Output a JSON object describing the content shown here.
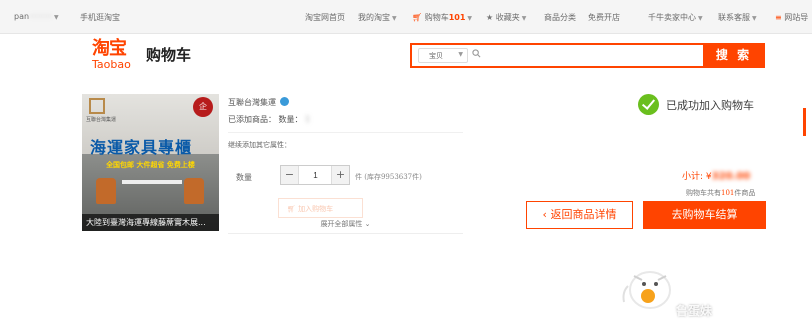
{
  "topbar": {
    "user": "pan",
    "user_blurred": "·········",
    "mobile": "手机逛淘宝",
    "home": "淘宝网首页",
    "my_taobao": "我的淘宝",
    "cart_label": "购物车",
    "cart_count": "101",
    "favorites": "收藏夹",
    "categories": "商品分类",
    "open_shop": "免费开店",
    "seller_center": "千牛卖家中心",
    "support": "联系客服",
    "sitemap": "网站导"
  },
  "header": {
    "logo_cn": "淘宝",
    "logo_en": "Taobao",
    "title": "购物车"
  },
  "search": {
    "scope": "宝贝",
    "value": "",
    "button": "搜 索"
  },
  "product": {
    "image_headline": "海運家具專櫃",
    "image_promo": "全国包邮 大件超省 免费上楼",
    "image_badge_left": "互聯台灣集運",
    "image_badge_right": "企",
    "image_caption": "大陸到臺灣海運專線藤蓆實木展...",
    "seller": "互聯台灣集運",
    "added_label": "已添加商品：",
    "added_qty_label": "数量：",
    "added_qty_blurred": "1",
    "add_other_attrs": "继续添加其它属性：",
    "qty_label": "数量",
    "qty_minus": "−",
    "qty_value": "1",
    "qty_plus": "+",
    "stock": "件 (库存9953637件)",
    "add_to_cart_faint": "加入购物车",
    "expand_attrs": "展开全部属性"
  },
  "right": {
    "success": "已成功加入购物车",
    "subtotal_label": "小计:",
    "subtotal_currency": "¥",
    "subtotal_amount_blurred": "320.00",
    "cart_summary_pre": "购物车共有",
    "cart_summary_count": "101",
    "cart_summary_post": "件商品",
    "back_button": "返回商品详情",
    "checkout_button": "去购物车结算"
  },
  "watermark": {
    "text": "鲁蛋妹"
  },
  "colors": {
    "brand": "#ff4400",
    "success": "#6abf1e"
  }
}
